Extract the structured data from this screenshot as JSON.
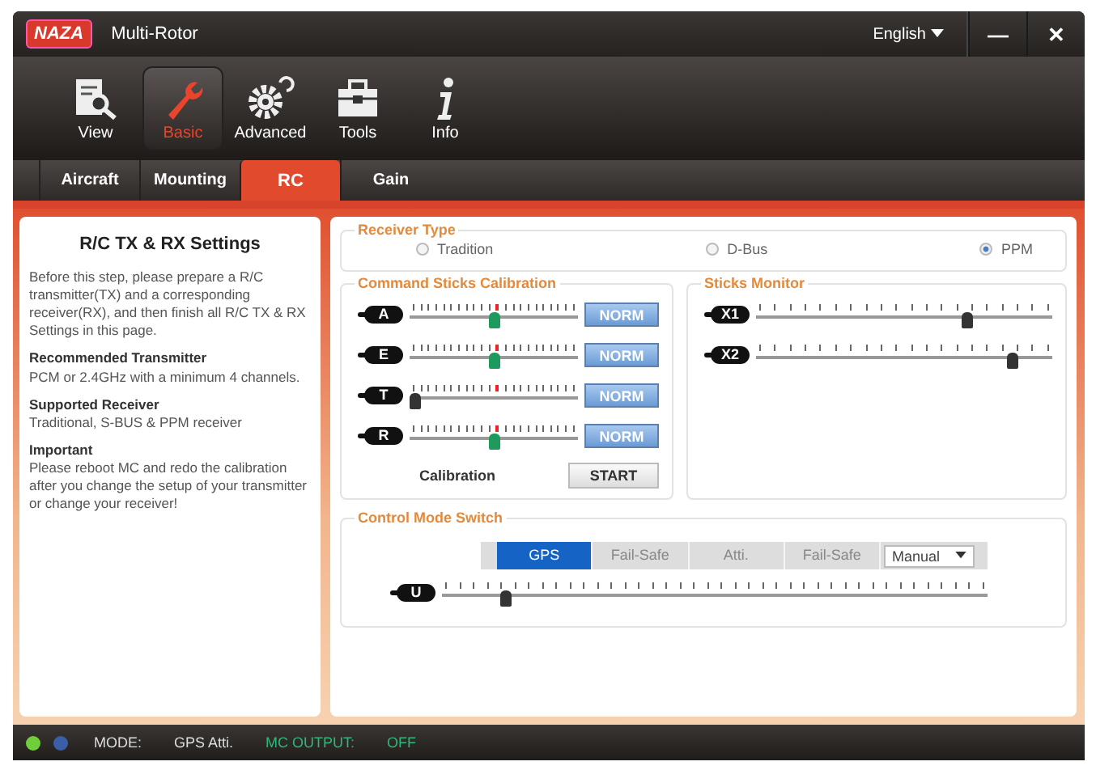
{
  "window": {
    "logo": "NAZA",
    "title": "Multi-Rotor",
    "language": "English",
    "minimize": "—",
    "close": "✕"
  },
  "toolbar": [
    {
      "kind": "view",
      "label": "View",
      "selected": false
    },
    {
      "kind": "basic",
      "label": "Basic",
      "selected": true
    },
    {
      "kind": "advanced",
      "label": "Advanced",
      "selected": false
    },
    {
      "kind": "tools",
      "label": "Tools",
      "selected": false
    },
    {
      "kind": "info",
      "label": "Info",
      "selected": false
    }
  ],
  "tabs": [
    {
      "label": "Aircraft",
      "selected": false
    },
    {
      "label": "Mounting",
      "selected": false
    },
    {
      "label": "RC",
      "selected": true
    },
    {
      "label": "Gain",
      "selected": false
    }
  ],
  "help": {
    "title": "R/C TX & RX Settings",
    "intro": "Before this step, please prepare a R/C transmitter(TX) and a corresponding receiver(RX), and then finish all R/C TX & RX Settings in this page.",
    "sections": [
      {
        "heading": "Recommended Transmitter",
        "text": "PCM or 2.4GHz with a minimum 4 channels."
      },
      {
        "heading": "Supported Receiver",
        "text": "Traditional, S-BUS & PPM receiver"
      },
      {
        "heading": "Important",
        "text": "Please reboot MC and redo the calibration after you change the setup of your transmitter or change your receiver!"
      }
    ]
  },
  "receiver_type": {
    "title": "Receiver Type",
    "options": [
      {
        "label": "Tradition",
        "selected": false
      },
      {
        "label": "D-Bus",
        "selected": false
      },
      {
        "label": "PPM",
        "selected": true
      }
    ]
  },
  "calibration": {
    "title": "Command Sticks Calibration",
    "channels": [
      {
        "name": "A",
        "level": 0.5,
        "active": true,
        "button": "NORM"
      },
      {
        "name": "E",
        "level": 0.5,
        "active": true,
        "button": "NORM"
      },
      {
        "name": "T",
        "level": 0.0,
        "active": false,
        "button": "NORM"
      },
      {
        "name": "R",
        "level": 0.5,
        "active": true,
        "button": "NORM"
      }
    ],
    "label": "Calibration",
    "button": "START"
  },
  "monitor": {
    "title": "Sticks Monitor",
    "channels": [
      {
        "name": "X1",
        "level": 0.72
      },
      {
        "name": "X2",
        "level": 0.88
      }
    ]
  },
  "mode_switch": {
    "title": "Control Mode Switch",
    "segments": [
      {
        "kind": "segment",
        "label": "GPS",
        "selected": true
      },
      {
        "kind": "segment",
        "label": "Fail-Safe",
        "selected": false
      },
      {
        "kind": "segment",
        "label": "Atti.",
        "selected": false
      },
      {
        "kind": "segment",
        "label": "Fail-Safe",
        "selected": false
      },
      {
        "kind": "dropdown",
        "label": "Manual",
        "selected": false
      }
    ],
    "channel": {
      "name": "U",
      "level": 0.11
    }
  },
  "status_bar": {
    "lights": [
      {
        "color": "#6fcf3a"
      },
      {
        "color": "#3a5fa8"
      }
    ],
    "mode_label": "MODE:",
    "mode": "GPS Atti.",
    "output_label": "MC OUTPUT:",
    "output": "OFF"
  }
}
